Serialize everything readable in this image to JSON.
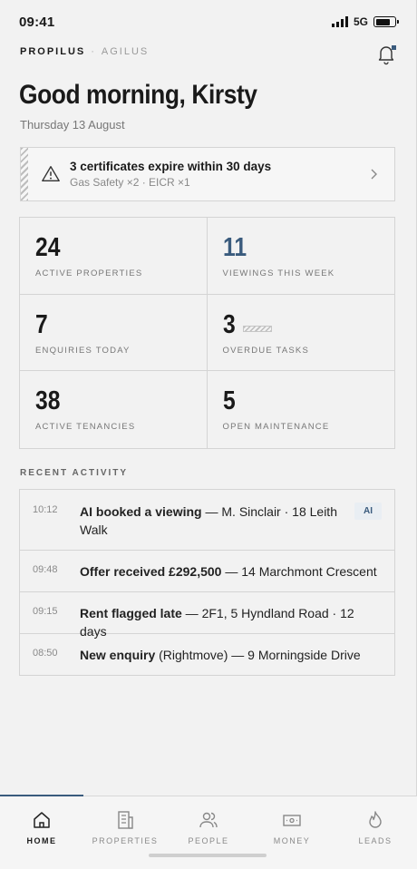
{
  "status_bar": {
    "time": "09:41",
    "network": "5G"
  },
  "brand": {
    "name": "PROPILUS",
    "separator": "·",
    "sub": "AGILUS"
  },
  "header": {
    "greeting": "Good morning, Kirsty",
    "date": "Thursday 13 August"
  },
  "alert": {
    "title": "3 certificates expire within 30 days",
    "detail": "Gas Safety ×2 · EICR ×1"
  },
  "stats": [
    {
      "value": "24",
      "label": "ACTIVE PROPERTIES"
    },
    {
      "value": "11",
      "label": "VIEWINGS THIS WEEK",
      "accent": "#3a5b7d"
    },
    {
      "value": "7",
      "label": "ENQUIRIES TODAY"
    },
    {
      "value": "3",
      "label": "OVERDUE TASKS"
    },
    {
      "value": "38",
      "label": "ACTIVE TENANCIES"
    },
    {
      "value": "5",
      "label": "OPEN MAINTENANCE"
    }
  ],
  "recent_activity": {
    "heading": "RECENT ACTIVITY",
    "items": [
      {
        "time": "10:12",
        "bold": "AI booked a viewing",
        "rest": " — M. Sinclair · 18 Leith Walk",
        "badge": "AI"
      },
      {
        "time": "09:48",
        "bold": "Offer received £292,500",
        "rest": " — 14 Marchmont Crescent"
      },
      {
        "time": "09:15",
        "bold": "Rent flagged late",
        "rest": " — 2F1, 5 Hyndland Road · 12 days"
      },
      {
        "time": "08:50",
        "bold": "New enquiry",
        "rest": " (Rightmove) — 9 Morningside Drive"
      }
    ]
  },
  "nav": {
    "items": [
      {
        "label": "HOME",
        "icon": "home-icon",
        "active": true
      },
      {
        "label": "PROPERTIES",
        "icon": "building-icon"
      },
      {
        "label": "PEOPLE",
        "icon": "people-icon"
      },
      {
        "label": "MONEY",
        "icon": "banknote-icon"
      },
      {
        "label": "LEADS",
        "icon": "flame-icon"
      }
    ]
  },
  "colors": {
    "accent": "#3a5b7d",
    "background": "#f2f2f2",
    "border": "#d4d4d4"
  }
}
